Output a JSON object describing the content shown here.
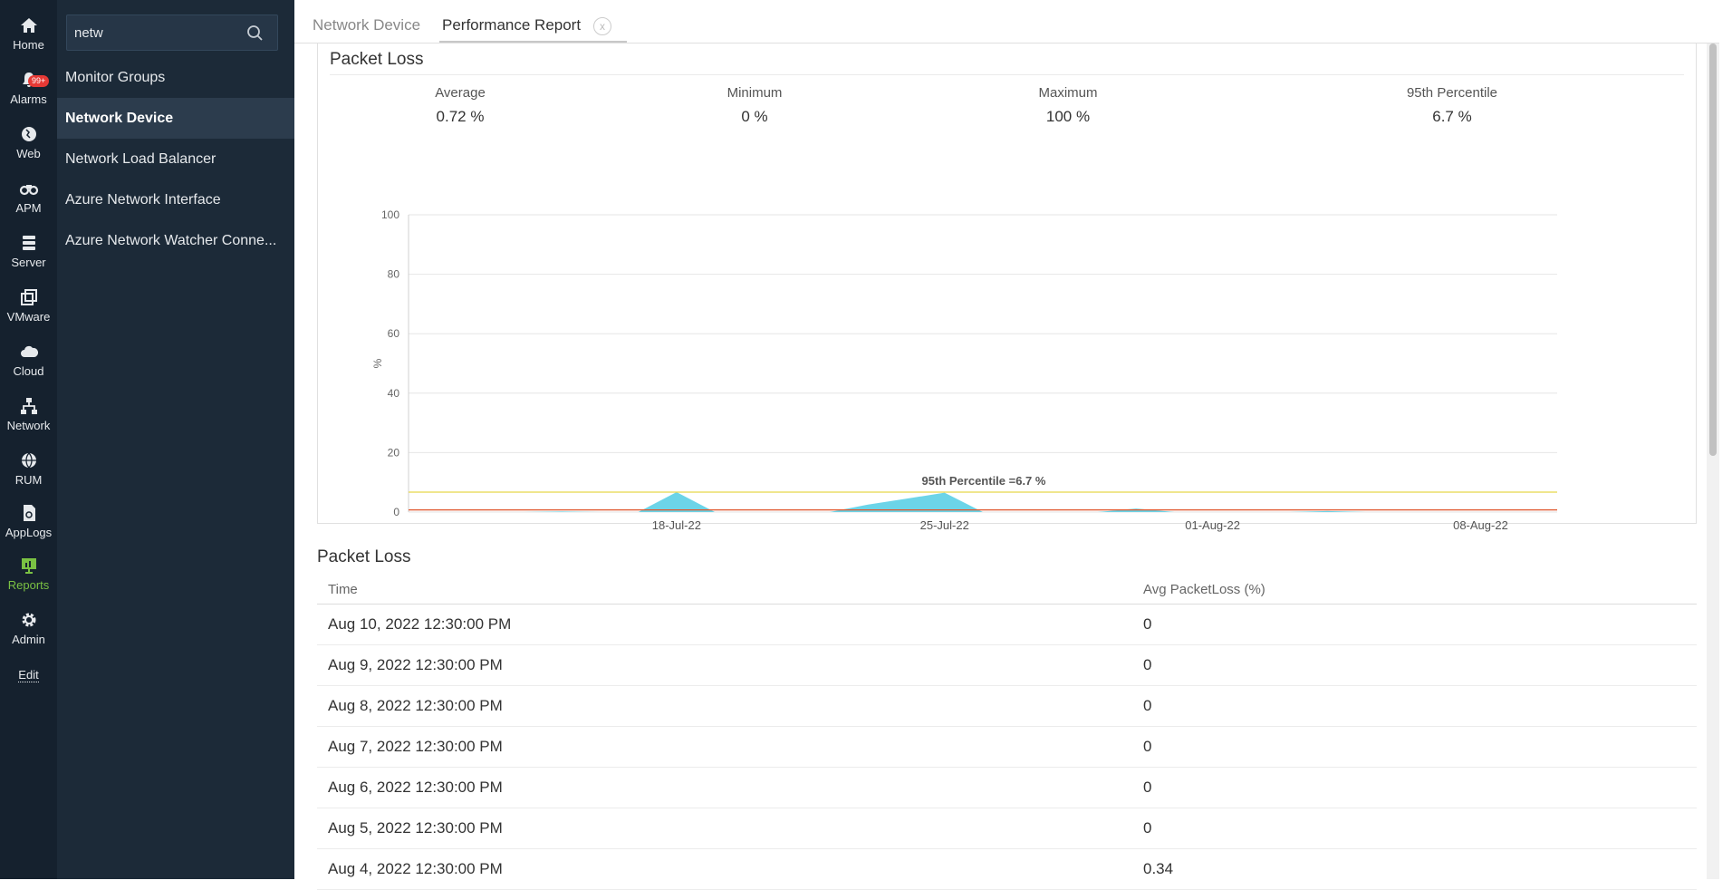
{
  "rail": {
    "items": [
      {
        "label": "Home",
        "icon": "home-icon"
      },
      {
        "label": "Alarms",
        "icon": "bell-icon",
        "badge": "99+"
      },
      {
        "label": "Web",
        "icon": "globe-icon"
      },
      {
        "label": "APM",
        "icon": "binoculars-icon"
      },
      {
        "label": "Server",
        "icon": "server-icon"
      },
      {
        "label": "VMware",
        "icon": "vm-icon"
      },
      {
        "label": "Cloud",
        "icon": "cloud-icon"
      },
      {
        "label": "Network",
        "icon": "network-icon"
      },
      {
        "label": "RUM",
        "icon": "rum-icon"
      },
      {
        "label": "AppLogs",
        "icon": "applogs-icon"
      },
      {
        "label": "Reports",
        "icon": "reports-icon"
      },
      {
        "label": "Admin",
        "icon": "gear-icon"
      }
    ],
    "edit_label": "Edit",
    "active_color": "#7ac143"
  },
  "sidebar": {
    "search_value": "netw",
    "items": [
      {
        "label": "Monitor Groups"
      },
      {
        "label": "Network Device"
      },
      {
        "label": "Network Load Balancer"
      },
      {
        "label": "Azure Network Interface"
      },
      {
        "label": "Azure Network Watcher Conne..."
      }
    ]
  },
  "tabs": [
    {
      "label": "Network Device"
    },
    {
      "label": "Performance Report"
    }
  ],
  "tab_close": "x",
  "report": {
    "title": "Packet Loss",
    "stats": [
      {
        "label": "Average",
        "value": "0.72 %"
      },
      {
        "label": "Minimum",
        "value": "0 %"
      },
      {
        "label": "Maximum",
        "value": "100 %"
      },
      {
        "label": "95th Percentile",
        "value": "6.7 %"
      }
    ]
  },
  "chart_data": {
    "type": "area",
    "ylabel": "%",
    "ylim": [
      0,
      100
    ],
    "yticks": [
      0,
      20,
      40,
      60,
      80,
      100
    ],
    "xticks": [
      "18-Jul-22",
      "25-Jul-22",
      "01-Aug-22",
      "08-Aug-22"
    ],
    "x": [
      "11-Jul-22",
      "12-Jul-22",
      "13-Jul-22",
      "14-Jul-22",
      "15-Jul-22",
      "16-Jul-22",
      "17-Jul-22",
      "18-Jul-22",
      "19-Jul-22",
      "20-Jul-22",
      "21-Jul-22",
      "22-Jul-22",
      "23-Jul-22",
      "24-Jul-22",
      "25-Jul-22",
      "26-Jul-22",
      "27-Jul-22",
      "28-Jul-22",
      "29-Jul-22",
      "30-Jul-22",
      "31-Jul-22",
      "01-Aug-22",
      "02-Aug-22",
      "03-Aug-22",
      "04-Aug-22",
      "05-Aug-22",
      "06-Aug-22",
      "07-Aug-22",
      "08-Aug-22",
      "09-Aug-22",
      "10-Aug-22"
    ],
    "series": [
      {
        "values": [
          0,
          0,
          0,
          0,
          0.2,
          0,
          0,
          6.7,
          0,
          0,
          0,
          0,
          2.5,
          4.5,
          6.5,
          0,
          0,
          0,
          0,
          1.2,
          0,
          0,
          0,
          0,
          0.34,
          0,
          0,
          0,
          0,
          0,
          0
        ],
        "color": "#5ccfe6"
      }
    ],
    "reference_lines": [
      {
        "label": "95th Percentile =6.7 %",
        "value": 6.7,
        "color": "#e8d64a"
      },
      {
        "value": 0.72,
        "color": "#e0552b"
      }
    ],
    "grid": true
  },
  "table": {
    "title": "Packet Loss",
    "columns": [
      "Time",
      "Avg PacketLoss (%)"
    ],
    "rows": [
      [
        "Aug 10, 2022 12:30:00 PM",
        "0"
      ],
      [
        "Aug 9, 2022 12:30:00 PM",
        "0"
      ],
      [
        "Aug 8, 2022 12:30:00 PM",
        "0"
      ],
      [
        "Aug 7, 2022 12:30:00 PM",
        "0"
      ],
      [
        "Aug 6, 2022 12:30:00 PM",
        "0"
      ],
      [
        "Aug 5, 2022 12:30:00 PM",
        "0"
      ],
      [
        "Aug 4, 2022 12:30:00 PM",
        "0.34"
      ]
    ]
  }
}
